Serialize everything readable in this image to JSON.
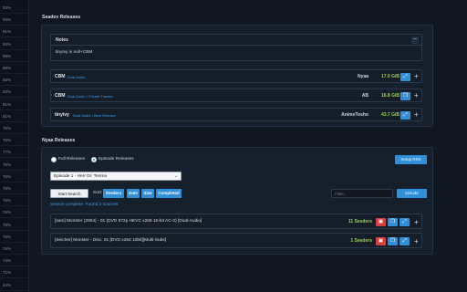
{
  "sidebar": {
    "percentages": [
      "93%",
      "92%",
      "91%",
      "90%",
      "86%",
      "86%",
      "85%",
      "83%",
      "81%",
      "81%",
      "76%",
      "76%",
      "77%",
      "76%",
      "76%",
      "76%",
      "76%",
      "76%",
      "76%",
      "76%",
      "76%",
      "74%",
      "71%",
      "64%",
      "63%"
    ]
  },
  "seadex": {
    "title": "Seadex Releases",
    "notes": {
      "title": "Notes",
      "collapse_label": "–",
      "body": "tinyivy is null+CBM"
    },
    "releases": [
      {
        "group": "CBM",
        "tags": "Dual Audio",
        "site": "Nyaa",
        "size": "17.0 GiB"
      },
      {
        "group": "CBM",
        "tags": "Dual Audio • Private Tracker",
        "site": "AB",
        "size": "16.8 GiB"
      },
      {
        "group": "tinyivy",
        "tags": "Dual Audio • Best Release",
        "site": "AnimeTosho",
        "size": "43.7 GiB"
      }
    ],
    "add_label": "+",
    "link_icon": "link-icon",
    "copy_icon": "copy-icon"
  },
  "nyaa": {
    "title": "Nyaa Releases",
    "radio_full": "Full Releases",
    "radio_episode": "Episode Releases",
    "selected_mode": "episode",
    "setup_rss": "Setup RSS",
    "episode_select": "Episode 1 - Herr Dr. Tenma",
    "start_search": "Start Search",
    "sort_label": "Sort:",
    "sort_options": [
      "Seeders",
      "Date",
      "Size",
      "Completed"
    ],
    "filter_placeholder": "Filter...",
    "include_label": "Include",
    "status": "Search complete. Found 2 sources",
    "results": [
      {
        "title": "[sam] Monster (2004) - 01 (DVD 572p HEVC x265 10-bit AC-3) [Dual-Audio]",
        "seeders": "11 Seeders"
      },
      {
        "title": "[Seicher] Monster - Disc. 01 [DVD x264 10bit][Multi-Subs]",
        "seeders": "1 Seeders"
      }
    ],
    "add_label": "+"
  },
  "colors": {
    "background": "#0f1620",
    "panel": "#16202c",
    "accent": "#2f8fd8",
    "size_green": "#9ad34a",
    "danger": "#d23f3f"
  }
}
